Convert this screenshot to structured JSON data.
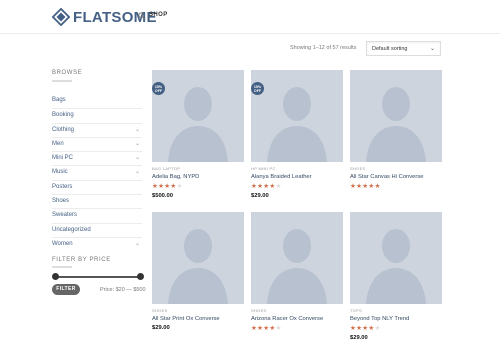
{
  "header": {
    "logo_text": "FLATSOME",
    "nav_shop": "SHOP"
  },
  "toolbar": {
    "results_text": "Showing 1–12 of 57 results",
    "sort_selected": "Default sorting"
  },
  "sidebar": {
    "browse_title": "BROWSE",
    "categories": [
      {
        "label": "Bags",
        "has_children": false
      },
      {
        "label": "Booking",
        "has_children": false
      },
      {
        "label": "Clothing",
        "has_children": true
      },
      {
        "label": "Men",
        "has_children": true
      },
      {
        "label": "Mini PC",
        "has_children": true
      },
      {
        "label": "Music",
        "has_children": true
      },
      {
        "label": "Posters",
        "has_children": false
      },
      {
        "label": "Shoes",
        "has_children": false
      },
      {
        "label": "Sweaters",
        "has_children": false
      },
      {
        "label": "Uncategorized",
        "has_children": false
      },
      {
        "label": "Women",
        "has_children": true
      }
    ],
    "filter_title": "FILTER BY PRICE",
    "filter_button": "FILTER",
    "price_label": "Price: $20 — $500",
    "price_range": [
      20,
      500
    ]
  },
  "products": [
    {
      "category": "BAG LAPTOP",
      "name": "Adelia Bag, NYPD",
      "rating": 4,
      "price": "$500.00",
      "badge": "15% OFF"
    },
    {
      "category": "HP MINI PC",
      "name": "Alanya Braided Leather",
      "rating": 4,
      "price": "$29.00",
      "badge": "15% OFF"
    },
    {
      "category": "SHOES",
      "name": "All Star Canvas Hi Converse",
      "rating": 4.5,
      "price": "",
      "badge": ""
    },
    {
      "category": "SHOES",
      "name": "All Star Print Ox Converse",
      "rating": 0,
      "price": "$29.00",
      "badge": ""
    },
    {
      "category": "SHOES",
      "name": "Arizona Racer Ox Converse",
      "rating": 4,
      "price": "",
      "badge": ""
    },
    {
      "category": "TOPS",
      "name": "Beyond Top NLY Trend",
      "rating": 3.5,
      "price": "$29.00",
      "badge": ""
    }
  ],
  "colors": {
    "brand": "#446084",
    "stars": "#d26e4b",
    "placeholder": "#cdd4de"
  }
}
